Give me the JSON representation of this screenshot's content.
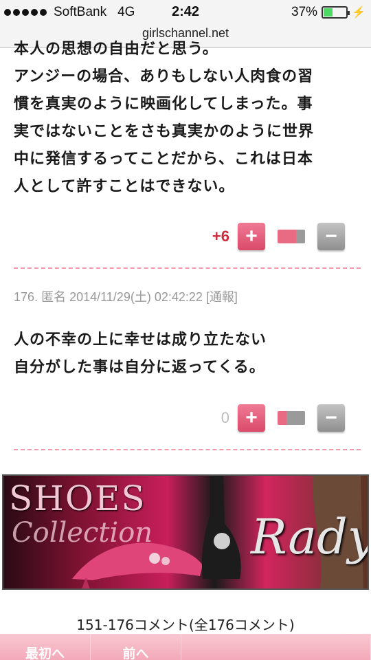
{
  "status_bar": {
    "carrier": "SoftBank",
    "network": "4G",
    "time": "2:42",
    "battery": "37%",
    "battery_level": 0.37
  },
  "url": "girlschannel.net",
  "comment_175": {
    "lines": [
      "本人の思想の自由だと思う。",
      "アンジーの場合、ありもしない人肉食の習",
      "慣を真実のように映画化してしまった。事",
      "実ではないことをさも真実かのように世界",
      "中に発信するってことだから、これは日本",
      "人として許すことはできない。"
    ],
    "votes": "+6",
    "vote_color": "#cc2b3b",
    "ratio_plus": 0.68
  },
  "comment_176": {
    "number": "176.",
    "author": "匿名",
    "date": "2014/11/29(土) 02:42:22",
    "report": "[通報]",
    "lines": [
      "人の不幸の上に幸せは成り立たない",
      "自分がした事は自分に返ってくる。"
    ],
    "votes": "0",
    "vote_color": "#bbbbbb",
    "ratio_plus": 0.32
  },
  "vote_buttons": {
    "plus": "+",
    "minus": "−"
  },
  "banner": {
    "title": "SHOES",
    "subtitle": "Collection",
    "brand": "Rady"
  },
  "comment_count": "151-176コメント(全176コメント)",
  "pager": {
    "first": "最初へ",
    "prev": "前へ"
  }
}
